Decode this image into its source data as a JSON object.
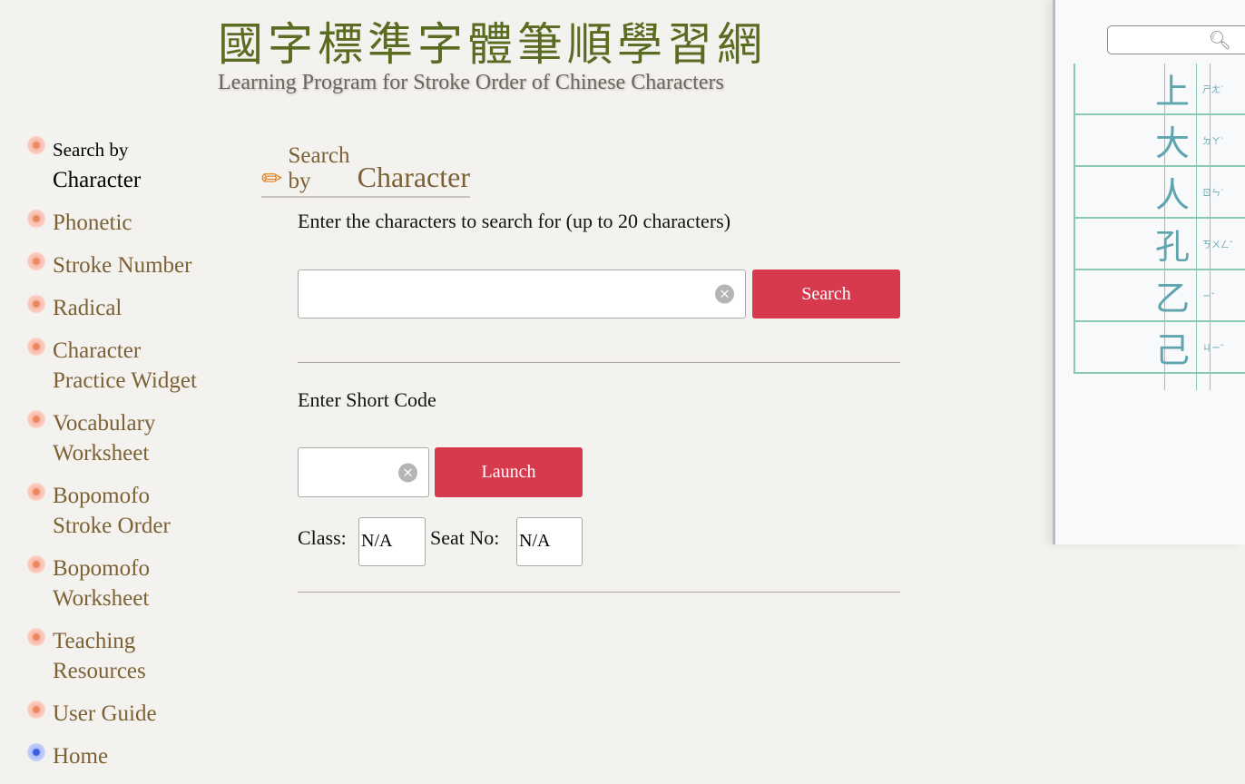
{
  "header": {
    "logo_zh": "國字標準字體筆順學習網",
    "logo_en": "Learning Program for Stroke Order of Chinese Characters"
  },
  "decor": {
    "chars": [
      "上",
      "大",
      "人",
      "孔",
      "乙",
      "己"
    ],
    "zhuyin": [
      "ㄕㄤˋ",
      "ㄉㄚˋ",
      "ㄖㄣˊ",
      "ㄎㄨㄥˇ",
      "ㄧˇ",
      "ㄐㄧˇ"
    ]
  },
  "top_search": {
    "value": "",
    "icon": "search-icon"
  },
  "sidebar": {
    "items": [
      {
        "label": "Search by",
        "label2": "Character",
        "active": true
      },
      {
        "label": "Phonetic"
      },
      {
        "label": "Stroke Number"
      },
      {
        "label": "Radical"
      },
      {
        "label": "Character Practice Widget"
      },
      {
        "label": "Vocabulary Worksheet"
      },
      {
        "label": "Bopomofo Stroke Order"
      },
      {
        "label": "Bopomofo Worksheet"
      },
      {
        "label": "Teaching Resources"
      },
      {
        "label": "User Guide"
      },
      {
        "label": "Home"
      }
    ]
  },
  "main": {
    "title_small": "Search by",
    "title_big": "Character",
    "search_prompt": "Enter the characters to search for (up to 20 characters)",
    "search_value": "",
    "search_label": "Search",
    "short_code_label": "Enter Short Code",
    "short_code_value": "",
    "launch_label": "Launch",
    "class_label": "Class:",
    "class_value": "N/A",
    "seat_label": "Seat No:",
    "seat_value": "N/A"
  },
  "colors": {
    "accent": "#d73a4d",
    "link": "#7d6136",
    "logo": "#5a6b22"
  }
}
